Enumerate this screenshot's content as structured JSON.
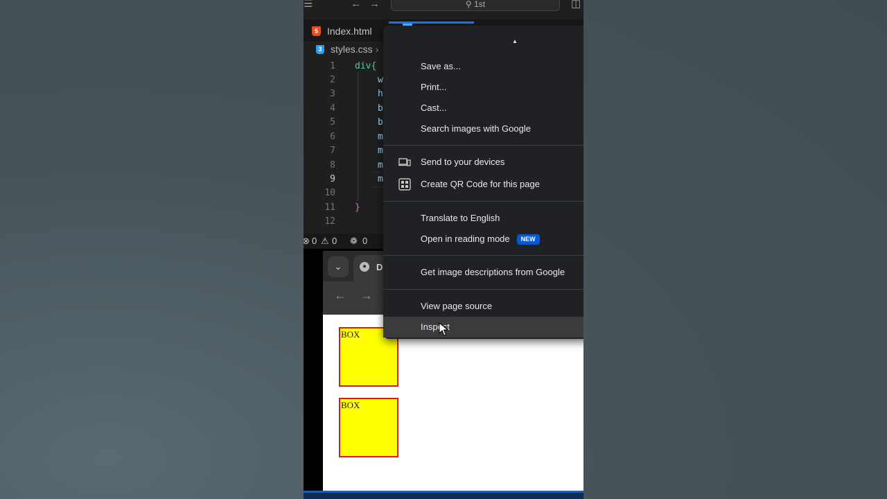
{
  "vscode": {
    "search_text": "1st",
    "tabs": [
      {
        "label": "Index.html",
        "icon": "html5-icon"
      }
    ],
    "breadcrumb": {
      "file": "styles.css",
      "icon": "css3-icon"
    },
    "editor": {
      "line_numbers": [
        "1",
        "2",
        "3",
        "4",
        "5",
        "6",
        "7",
        "8",
        "9",
        "10",
        "11",
        "12"
      ],
      "active_line": "9",
      "code_lines": [
        {
          "line": "1",
          "text": "div{"
        },
        {
          "line": "2",
          "text": "w"
        },
        {
          "line": "3",
          "text": "h"
        },
        {
          "line": "4",
          "text": "b"
        },
        {
          "line": "5",
          "text": "b"
        },
        {
          "line": "6",
          "text": "m"
        },
        {
          "line": "7",
          "text": "m"
        },
        {
          "line": "8",
          "text": "m"
        },
        {
          "line": "9",
          "text": "m"
        },
        {
          "line": "11",
          "text": "}"
        }
      ]
    },
    "status": {
      "errors": "0",
      "warnings": "0",
      "ports": "0"
    }
  },
  "browser": {
    "tab_label": "D",
    "boxes": [
      "BOX",
      "BOX"
    ],
    "colors": {
      "box_fill": "#ffff00",
      "box_border": "#d21b1b"
    }
  },
  "context_menu": {
    "groups": [
      [
        {
          "label": "Save as..."
        },
        {
          "label": "Print..."
        },
        {
          "label": "Cast..."
        },
        {
          "label": "Search images with Google"
        }
      ],
      [
        {
          "label": "Send to your devices",
          "icon": "devices-icon"
        },
        {
          "label": "Create QR Code for this page",
          "icon": "qr-code-icon"
        }
      ],
      [
        {
          "label": "Translate to English"
        },
        {
          "label": "Open in reading mode",
          "badge": "NEW"
        }
      ],
      [
        {
          "label": "Get image descriptions from Google"
        }
      ],
      [
        {
          "label": "View page source"
        },
        {
          "label": "Inspect",
          "hovered": true
        }
      ]
    ]
  }
}
